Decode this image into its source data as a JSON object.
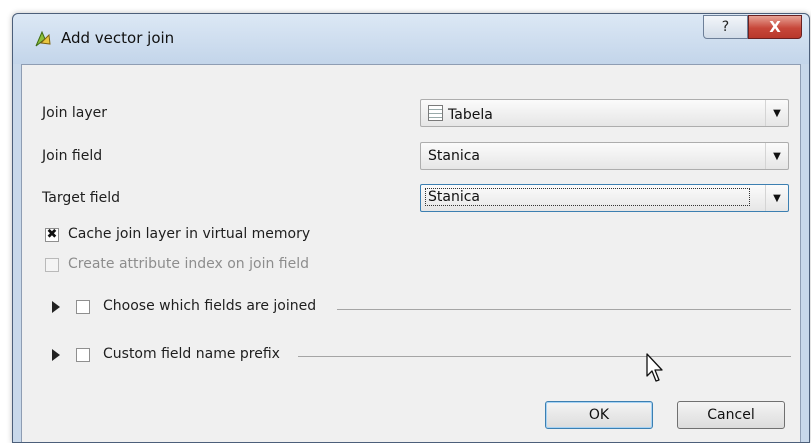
{
  "window": {
    "title": "Add vector join",
    "help_label": "?",
    "close_label": "X"
  },
  "form": {
    "join_layer": {
      "label": "Join layer",
      "value": "Tabela",
      "icon": "table-layer-icon"
    },
    "join_field": {
      "label": "Join field",
      "value": "Stanica"
    },
    "target_field": {
      "label": "Target field",
      "value": "Stanica"
    }
  },
  "options": {
    "cache": {
      "label": "Cache join layer in virtual memory",
      "checked": true,
      "mark": "✖"
    },
    "index": {
      "label": "Create attribute index on join field",
      "checked": false,
      "enabled": false
    }
  },
  "groups": {
    "fields": {
      "label": "Choose which fields are joined",
      "checked": false,
      "expanded": false
    },
    "prefix": {
      "label": "Custom field name prefix",
      "checked": false,
      "expanded": false
    }
  },
  "buttons": {
    "ok": "OK",
    "cancel": "Cancel"
  },
  "dropdown_arrow": "▼"
}
